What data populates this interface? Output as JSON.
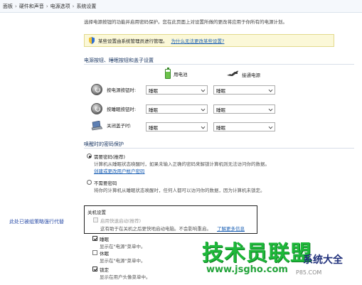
{
  "breadcrumb": {
    "items": [
      "面板",
      "硬件和声音",
      "电源选项",
      "系统设置"
    ],
    "separator": "›"
  },
  "top_desc": "选择电源按钮的功能并启用密码保护。您在此页面上对设置所做的更改将应用于你所有的电源计划。",
  "admin_bar": {
    "text": "某些设置由系统管理员进行管理。",
    "link": "为什么无法更改某些设置?"
  },
  "buttons_section": {
    "title": "电源按钮、睡眠按钮和盖子设置",
    "col_battery": "用电池",
    "col_plugged": "接通电源",
    "rows": [
      {
        "label": "按电源按钮时:",
        "battery": "睡眠",
        "plugged": "睡眠"
      },
      {
        "label": "按睡眠按钮时:",
        "battery": "睡眠",
        "plugged": "睡眠"
      },
      {
        "label": "关闭盖子时:",
        "battery": "睡眠",
        "plugged": "睡眠"
      }
    ]
  },
  "password_section": {
    "title": "唤醒时的密码保护",
    "require_label": "需要密码(推荐)",
    "require_desc": "计算机从睡眠状态唤醒时，如果未输入正确的密码来解锁计算机则无法访问你的数据。",
    "require_link": "创建或更改用户帐户密码",
    "norequire_label": "不需要密码",
    "norequire_desc": "将你的计算机从睡眠状态唤醒时，任何人都可以访问你的数据，因为计算机未锁定。"
  },
  "shutdown_section": {
    "title": "关机设置",
    "fast_startup_label": "启用快速启动(推荐)",
    "fast_startup_desc": "这有助于在关机之后更快地启动电脑。不会影响重启。",
    "fast_startup_link": "了解更多信息",
    "sleep_label": "睡眠",
    "sleep_desc": "显示在\"电源\"菜单中。",
    "hibernate_label": "休眠",
    "hibernate_desc": "显示在\"电源\"菜单中。",
    "lock_label": "锁定",
    "lock_desc": "显示在用户头像菜单中。"
  },
  "annotation": "此处已被组策略强行代替",
  "watermark": {
    "cn": "技术员联盟",
    "sys": "系统大全",
    "url": "www.jsgho.com",
    "tag": "P85.COM"
  },
  "colors": {
    "accent_link": "#1a5fb4",
    "watermark_green": "#1eb83a",
    "admin_bg": "#fbf8d8"
  }
}
